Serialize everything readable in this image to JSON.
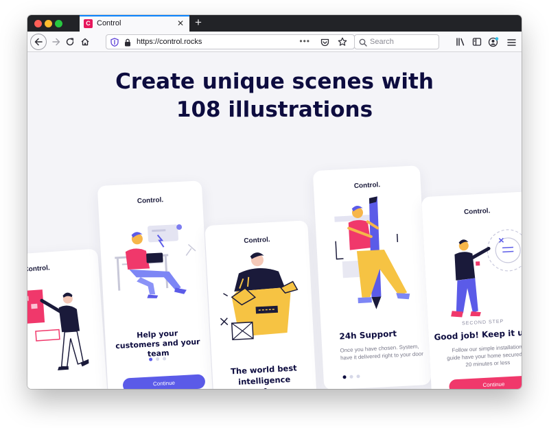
{
  "browser": {
    "tab_title": "Control",
    "tab_favicon_letter": "C",
    "url": "https://control.rocks",
    "search_placeholder": "Search",
    "url_overflow": "•••"
  },
  "page": {
    "headline_line1": "Create unique scenes with",
    "headline_line2": "108 illustrations"
  },
  "cards": [
    {
      "brand": "Control."
    },
    {
      "brand": "Control.",
      "title": "Help your customers and your team",
      "button": "Continue"
    },
    {
      "brand": "Control.",
      "title_line1": "The world best",
      "title_line2": "intelligence platform"
    },
    {
      "brand": "Control.",
      "title": "24h Support",
      "body": "Once you have chosen. System, have it delivered right to your door"
    },
    {
      "brand": "Control.",
      "eyebrow": "SECOND STEP",
      "title": "Good job! Keep it up!",
      "body": "Follow our simple installation guide have your home secured in 20 minutes or less",
      "button": "Continue"
    }
  ],
  "colors": {
    "accent": "#5b5be8",
    "brand": "#e6175c",
    "navy": "#0d0c3f",
    "yellow": "#f6c343",
    "red_button": "#f0386b"
  },
  "icons": [
    "back-arrow-icon",
    "forward-arrow-icon",
    "reload-icon",
    "home-icon",
    "shield-icon",
    "lock-icon",
    "pocket-icon",
    "star-icon",
    "search-icon",
    "library-icon",
    "sidebar-icon",
    "account-icon",
    "menu-icon",
    "close-icon",
    "plus-icon"
  ]
}
